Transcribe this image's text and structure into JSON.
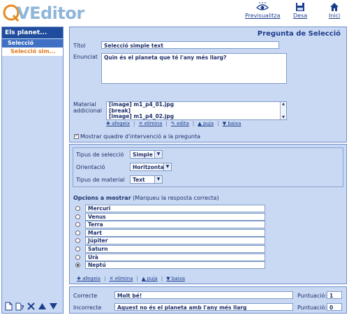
{
  "app": {
    "logo_letter": "Q",
    "logo_text": "VEditor"
  },
  "toolbar": {
    "preview": "Previsualitza",
    "save": "Desa",
    "home": "Inici"
  },
  "sidebar": {
    "title": "Els planet...",
    "selected_item": "Selecció",
    "sub_item": "Selecció sim..."
  },
  "form": {
    "heading": "Pregunta de Selecció",
    "title_label": "Títol",
    "title_value": "Selecció simple text",
    "statement_label": "Enunciat",
    "statement_value": "Quin és el planeta que té l'any més llarg?",
    "material_label": "Material addicional",
    "material_items": [
      "[image] m1_p4_01.jpg",
      "[break]",
      "[image] m1_p4_02.jpg"
    ],
    "material_actions": {
      "add": "afegeix",
      "remove": "elimina",
      "edit": "edita",
      "up": "puja",
      "down": "baixa"
    },
    "show_frame_label": "Mostrar quadre d'intervenció a la pregunta",
    "show_frame_checked": true
  },
  "settings": {
    "selection_type_label": "Tipus de selecció",
    "selection_type_value": "Simple",
    "orientation_label": "Orientació",
    "orientation_value": "Horitzontal",
    "material_type_label": "Tipus de material",
    "material_type_value": "Text"
  },
  "options": {
    "heading": "Opcions a mostrar",
    "hint": "(Marqueu la resposta correcta)",
    "items": [
      "Mercuri",
      "Venus",
      "Terra",
      "Mart",
      "Júpiter",
      "Saturn",
      "Urà",
      "Neptú"
    ],
    "correct_index": 7,
    "actions": {
      "add": "afegeix",
      "remove": "elimina",
      "up": "puja",
      "down": "baixa"
    }
  },
  "feedback": {
    "correct_label": "Correcte",
    "correct_value": "Molt bé!",
    "incorrect_label": "Incorrecte",
    "incorrect_value": "Aquest no és el planeta amb l'any més llarg",
    "score_label": "Puntuació:",
    "correct_score": "1",
    "incorrect_score": "0"
  },
  "colors": {
    "panel_bg": "#c9d9f3",
    "sidebar_header": "#1f4c9c",
    "sidebar_selected": "#3e70c4",
    "sub_item_text": "#e07a1a"
  }
}
